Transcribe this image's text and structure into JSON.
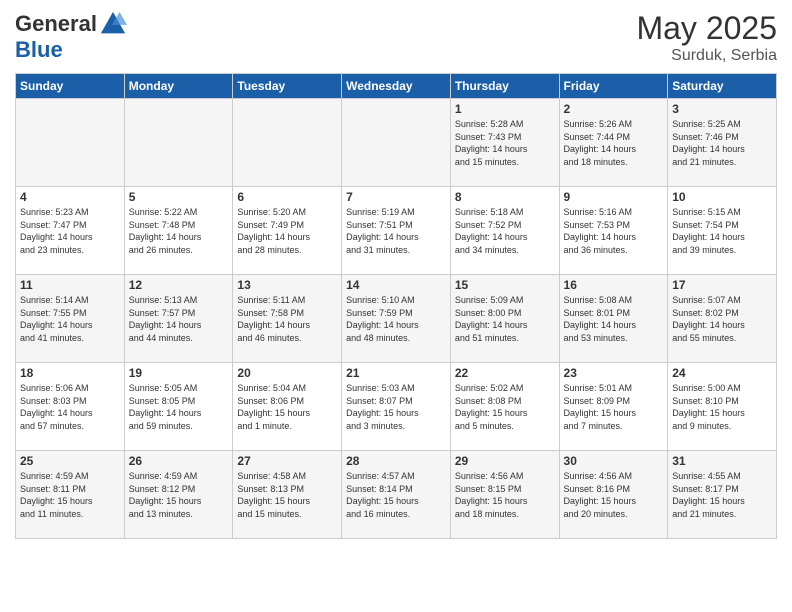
{
  "header": {
    "logo_general": "General",
    "logo_blue": "Blue",
    "month_year": "May 2025",
    "location": "Surduk, Serbia"
  },
  "days_of_week": [
    "Sunday",
    "Monday",
    "Tuesday",
    "Wednesday",
    "Thursday",
    "Friday",
    "Saturday"
  ],
  "weeks": [
    [
      {
        "day": "",
        "content": ""
      },
      {
        "day": "",
        "content": ""
      },
      {
        "day": "",
        "content": ""
      },
      {
        "day": "",
        "content": ""
      },
      {
        "day": "1",
        "content": "Sunrise: 5:28 AM\nSunset: 7:43 PM\nDaylight: 14 hours\nand 15 minutes."
      },
      {
        "day": "2",
        "content": "Sunrise: 5:26 AM\nSunset: 7:44 PM\nDaylight: 14 hours\nand 18 minutes."
      },
      {
        "day": "3",
        "content": "Sunrise: 5:25 AM\nSunset: 7:46 PM\nDaylight: 14 hours\nand 21 minutes."
      }
    ],
    [
      {
        "day": "4",
        "content": "Sunrise: 5:23 AM\nSunset: 7:47 PM\nDaylight: 14 hours\nand 23 minutes."
      },
      {
        "day": "5",
        "content": "Sunrise: 5:22 AM\nSunset: 7:48 PM\nDaylight: 14 hours\nand 26 minutes."
      },
      {
        "day": "6",
        "content": "Sunrise: 5:20 AM\nSunset: 7:49 PM\nDaylight: 14 hours\nand 28 minutes."
      },
      {
        "day": "7",
        "content": "Sunrise: 5:19 AM\nSunset: 7:51 PM\nDaylight: 14 hours\nand 31 minutes."
      },
      {
        "day": "8",
        "content": "Sunrise: 5:18 AM\nSunset: 7:52 PM\nDaylight: 14 hours\nand 34 minutes."
      },
      {
        "day": "9",
        "content": "Sunrise: 5:16 AM\nSunset: 7:53 PM\nDaylight: 14 hours\nand 36 minutes."
      },
      {
        "day": "10",
        "content": "Sunrise: 5:15 AM\nSunset: 7:54 PM\nDaylight: 14 hours\nand 39 minutes."
      }
    ],
    [
      {
        "day": "11",
        "content": "Sunrise: 5:14 AM\nSunset: 7:55 PM\nDaylight: 14 hours\nand 41 minutes."
      },
      {
        "day": "12",
        "content": "Sunrise: 5:13 AM\nSunset: 7:57 PM\nDaylight: 14 hours\nand 44 minutes."
      },
      {
        "day": "13",
        "content": "Sunrise: 5:11 AM\nSunset: 7:58 PM\nDaylight: 14 hours\nand 46 minutes."
      },
      {
        "day": "14",
        "content": "Sunrise: 5:10 AM\nSunset: 7:59 PM\nDaylight: 14 hours\nand 48 minutes."
      },
      {
        "day": "15",
        "content": "Sunrise: 5:09 AM\nSunset: 8:00 PM\nDaylight: 14 hours\nand 51 minutes."
      },
      {
        "day": "16",
        "content": "Sunrise: 5:08 AM\nSunset: 8:01 PM\nDaylight: 14 hours\nand 53 minutes."
      },
      {
        "day": "17",
        "content": "Sunrise: 5:07 AM\nSunset: 8:02 PM\nDaylight: 14 hours\nand 55 minutes."
      }
    ],
    [
      {
        "day": "18",
        "content": "Sunrise: 5:06 AM\nSunset: 8:03 PM\nDaylight: 14 hours\nand 57 minutes."
      },
      {
        "day": "19",
        "content": "Sunrise: 5:05 AM\nSunset: 8:05 PM\nDaylight: 14 hours\nand 59 minutes."
      },
      {
        "day": "20",
        "content": "Sunrise: 5:04 AM\nSunset: 8:06 PM\nDaylight: 15 hours\nand 1 minute."
      },
      {
        "day": "21",
        "content": "Sunrise: 5:03 AM\nSunset: 8:07 PM\nDaylight: 15 hours\nand 3 minutes."
      },
      {
        "day": "22",
        "content": "Sunrise: 5:02 AM\nSunset: 8:08 PM\nDaylight: 15 hours\nand 5 minutes."
      },
      {
        "day": "23",
        "content": "Sunrise: 5:01 AM\nSunset: 8:09 PM\nDaylight: 15 hours\nand 7 minutes."
      },
      {
        "day": "24",
        "content": "Sunrise: 5:00 AM\nSunset: 8:10 PM\nDaylight: 15 hours\nand 9 minutes."
      }
    ],
    [
      {
        "day": "25",
        "content": "Sunrise: 4:59 AM\nSunset: 8:11 PM\nDaylight: 15 hours\nand 11 minutes."
      },
      {
        "day": "26",
        "content": "Sunrise: 4:59 AM\nSunset: 8:12 PM\nDaylight: 15 hours\nand 13 minutes."
      },
      {
        "day": "27",
        "content": "Sunrise: 4:58 AM\nSunset: 8:13 PM\nDaylight: 15 hours\nand 15 minutes."
      },
      {
        "day": "28",
        "content": "Sunrise: 4:57 AM\nSunset: 8:14 PM\nDaylight: 15 hours\nand 16 minutes."
      },
      {
        "day": "29",
        "content": "Sunrise: 4:56 AM\nSunset: 8:15 PM\nDaylight: 15 hours\nand 18 minutes."
      },
      {
        "day": "30",
        "content": "Sunrise: 4:56 AM\nSunset: 8:16 PM\nDaylight: 15 hours\nand 20 minutes."
      },
      {
        "day": "31",
        "content": "Sunrise: 4:55 AM\nSunset: 8:17 PM\nDaylight: 15 hours\nand 21 minutes."
      }
    ]
  ]
}
